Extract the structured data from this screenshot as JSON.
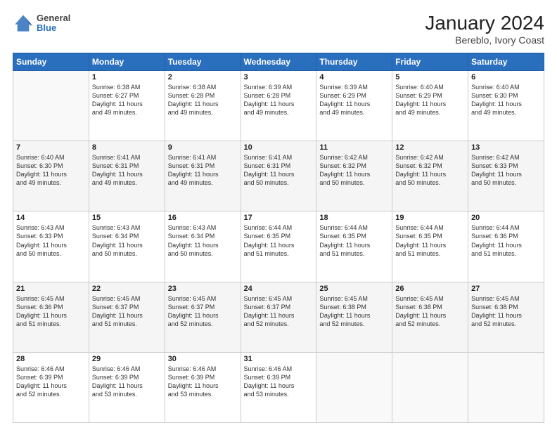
{
  "header": {
    "logo_line1": "General",
    "logo_line2": "Blue",
    "title": "January 2024",
    "subtitle": "Bereblo, Ivory Coast"
  },
  "calendar": {
    "days_of_week": [
      "Sunday",
      "Monday",
      "Tuesday",
      "Wednesday",
      "Thursday",
      "Friday",
      "Saturday"
    ],
    "weeks": [
      [
        {
          "day": "",
          "info": ""
        },
        {
          "day": "1",
          "info": "Sunrise: 6:38 AM\nSunset: 6:27 PM\nDaylight: 11 hours\nand 49 minutes."
        },
        {
          "day": "2",
          "info": "Sunrise: 6:38 AM\nSunset: 6:28 PM\nDaylight: 11 hours\nand 49 minutes."
        },
        {
          "day": "3",
          "info": "Sunrise: 6:39 AM\nSunset: 6:28 PM\nDaylight: 11 hours\nand 49 minutes."
        },
        {
          "day": "4",
          "info": "Sunrise: 6:39 AM\nSunset: 6:29 PM\nDaylight: 11 hours\nand 49 minutes."
        },
        {
          "day": "5",
          "info": "Sunrise: 6:40 AM\nSunset: 6:29 PM\nDaylight: 11 hours\nand 49 minutes."
        },
        {
          "day": "6",
          "info": "Sunrise: 6:40 AM\nSunset: 6:30 PM\nDaylight: 11 hours\nand 49 minutes."
        }
      ],
      [
        {
          "day": "7",
          "info": "Sunrise: 6:40 AM\nSunset: 6:30 PM\nDaylight: 11 hours\nand 49 minutes."
        },
        {
          "day": "8",
          "info": "Sunrise: 6:41 AM\nSunset: 6:31 PM\nDaylight: 11 hours\nand 49 minutes."
        },
        {
          "day": "9",
          "info": "Sunrise: 6:41 AM\nSunset: 6:31 PM\nDaylight: 11 hours\nand 49 minutes."
        },
        {
          "day": "10",
          "info": "Sunrise: 6:41 AM\nSunset: 6:31 PM\nDaylight: 11 hours\nand 50 minutes."
        },
        {
          "day": "11",
          "info": "Sunrise: 6:42 AM\nSunset: 6:32 PM\nDaylight: 11 hours\nand 50 minutes."
        },
        {
          "day": "12",
          "info": "Sunrise: 6:42 AM\nSunset: 6:32 PM\nDaylight: 11 hours\nand 50 minutes."
        },
        {
          "day": "13",
          "info": "Sunrise: 6:42 AM\nSunset: 6:33 PM\nDaylight: 11 hours\nand 50 minutes."
        }
      ],
      [
        {
          "day": "14",
          "info": "Sunrise: 6:43 AM\nSunset: 6:33 PM\nDaylight: 11 hours\nand 50 minutes."
        },
        {
          "day": "15",
          "info": "Sunrise: 6:43 AM\nSunset: 6:34 PM\nDaylight: 11 hours\nand 50 minutes."
        },
        {
          "day": "16",
          "info": "Sunrise: 6:43 AM\nSunset: 6:34 PM\nDaylight: 11 hours\nand 50 minutes."
        },
        {
          "day": "17",
          "info": "Sunrise: 6:44 AM\nSunset: 6:35 PM\nDaylight: 11 hours\nand 51 minutes."
        },
        {
          "day": "18",
          "info": "Sunrise: 6:44 AM\nSunset: 6:35 PM\nDaylight: 11 hours\nand 51 minutes."
        },
        {
          "day": "19",
          "info": "Sunrise: 6:44 AM\nSunset: 6:35 PM\nDaylight: 11 hours\nand 51 minutes."
        },
        {
          "day": "20",
          "info": "Sunrise: 6:44 AM\nSunset: 6:36 PM\nDaylight: 11 hours\nand 51 minutes."
        }
      ],
      [
        {
          "day": "21",
          "info": "Sunrise: 6:45 AM\nSunset: 6:36 PM\nDaylight: 11 hours\nand 51 minutes."
        },
        {
          "day": "22",
          "info": "Sunrise: 6:45 AM\nSunset: 6:37 PM\nDaylight: 11 hours\nand 51 minutes."
        },
        {
          "day": "23",
          "info": "Sunrise: 6:45 AM\nSunset: 6:37 PM\nDaylight: 11 hours\nand 52 minutes."
        },
        {
          "day": "24",
          "info": "Sunrise: 6:45 AM\nSunset: 6:37 PM\nDaylight: 11 hours\nand 52 minutes."
        },
        {
          "day": "25",
          "info": "Sunrise: 6:45 AM\nSunset: 6:38 PM\nDaylight: 11 hours\nand 52 minutes."
        },
        {
          "day": "26",
          "info": "Sunrise: 6:45 AM\nSunset: 6:38 PM\nDaylight: 11 hours\nand 52 minutes."
        },
        {
          "day": "27",
          "info": "Sunrise: 6:45 AM\nSunset: 6:38 PM\nDaylight: 11 hours\nand 52 minutes."
        }
      ],
      [
        {
          "day": "28",
          "info": "Sunrise: 6:46 AM\nSunset: 6:39 PM\nDaylight: 11 hours\nand 52 minutes."
        },
        {
          "day": "29",
          "info": "Sunrise: 6:46 AM\nSunset: 6:39 PM\nDaylight: 11 hours\nand 53 minutes."
        },
        {
          "day": "30",
          "info": "Sunrise: 6:46 AM\nSunset: 6:39 PM\nDaylight: 11 hours\nand 53 minutes."
        },
        {
          "day": "31",
          "info": "Sunrise: 6:46 AM\nSunset: 6:39 PM\nDaylight: 11 hours\nand 53 minutes."
        },
        {
          "day": "",
          "info": ""
        },
        {
          "day": "",
          "info": ""
        },
        {
          "day": "",
          "info": ""
        }
      ]
    ]
  }
}
